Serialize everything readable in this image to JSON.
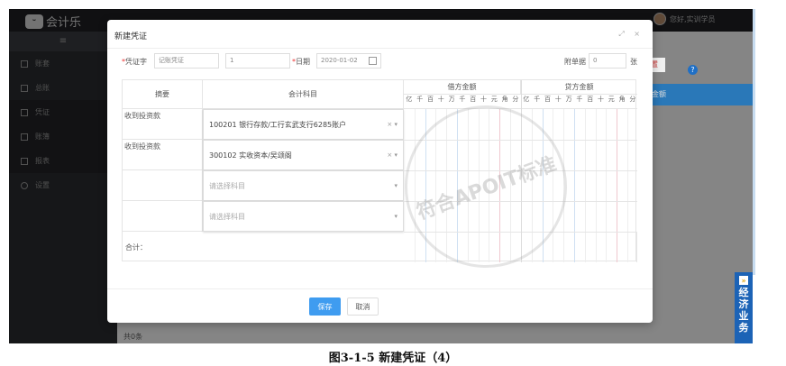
{
  "app": {
    "logo_text": "会计乐",
    "logo_face": "ᵕ",
    "user_greeting": "您好,实训学员"
  },
  "sidebar": {
    "menu_icon": "≡",
    "items": [
      {
        "label": "账套"
      },
      {
        "label": "总账"
      },
      {
        "label": "凭证"
      },
      {
        "label": "账簿"
      },
      {
        "label": "报表"
      },
      {
        "label": "设置"
      }
    ]
  },
  "background": {
    "red_button": "号重置",
    "help": "?",
    "blue_header": "金额",
    "count": "共0条"
  },
  "modal": {
    "title": "新建凭证",
    "tools": "⤢ ×",
    "voucher_label": "凭证字",
    "voucher_type": "记账凭证",
    "voucher_no": "1",
    "date_label": "日期",
    "date_value": "2020-01-02",
    "attach_label": "附单据",
    "attach_value": "0",
    "attach_unit": "张",
    "table": {
      "headers": {
        "summary": "摘要",
        "account": "会计科目",
        "debit": "借方金额",
        "credit": "贷方金额"
      },
      "digits": [
        "亿",
        "千",
        "百",
        "十",
        "万",
        "千",
        "百",
        "十",
        "元",
        "角",
        "分"
      ],
      "rows": [
        {
          "summary": "收到投资款",
          "account": "100201 银行存款/工行玄武支行6285账户"
        },
        {
          "summary": "收到投资款",
          "account": "300102 实收资本/吴颂阁"
        },
        {
          "summary": "",
          "account": "请选择科目"
        },
        {
          "summary": "",
          "account": "请选择科目"
        }
      ],
      "total_label": "合计："
    },
    "watermark": "符合APOIT标准",
    "save": "保存",
    "cancel": "取消"
  },
  "float_tab": {
    "arrow": "»",
    "label": "经济业务"
  },
  "caption": "图3-1-5 新建凭证（4）"
}
